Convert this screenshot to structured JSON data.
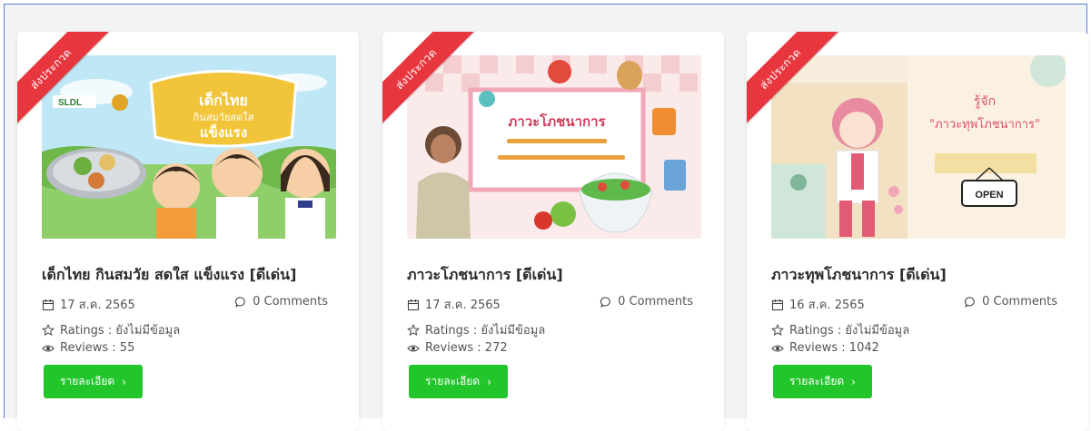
{
  "cards": [
    {
      "ribbon": "ส่งประกวด",
      "title": "เด็กไทย กินสมวัย สดใส แข็งแรง [ดีเด่น]",
      "date": "17 ส.ค. 2565",
      "comments": "0 Comments",
      "ratings": "Ratings : ยังไม่มีข้อมูล",
      "reviews": "Reviews : 55",
      "button": "รายละเอียด",
      "thumb_text": [
        "เด็กไทย",
        "กินสมวัยสดใส",
        "แข็งแรง"
      ],
      "thumb_logo": "SLDL"
    },
    {
      "ribbon": "ส่งประกวด",
      "title": "ภาวะโภชนาการ [ดีเด่น]",
      "date": "17 ส.ค. 2565",
      "comments": "0 Comments",
      "ratings": "Ratings : ยังไม่มีข้อมูล",
      "reviews": "Reviews : 272",
      "button": "รายละเอียด",
      "thumb_text": [
        "ภาวะโภชนาการ"
      ]
    },
    {
      "ribbon": "ส่งประกวด",
      "title": "ภาวะทุพโภชนาการ [ดีเด่น]",
      "date": "16 ส.ค. 2565",
      "comments": "0 Comments",
      "ratings": "Ratings : ยังไม่มีข้อมูล",
      "reviews": "Reviews : 1042",
      "button": "รายละเอียด",
      "thumb_text": [
        "รู้จัก",
        "\"ภาวะทุพโภชนาการ\"",
        "OPEN"
      ]
    }
  ],
  "icons": {
    "date": "calendar-icon",
    "comments": "comment-bubble-icon",
    "ratings": "star-outline-icon",
    "reviews": "eye-icon",
    "button": "chevron-right-icon"
  },
  "colors": {
    "ribbon": "#e8363f",
    "button": "#22c62b",
    "frame_border": "#5b7fd6",
    "background": "#f2f3f5"
  }
}
